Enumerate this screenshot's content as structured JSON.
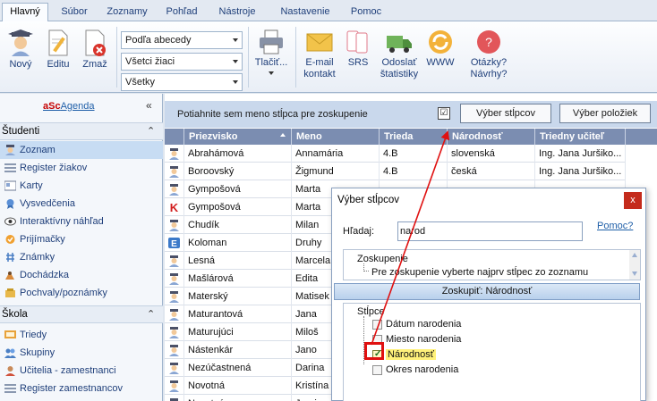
{
  "ribbon_tabs": [
    {
      "label": "Hlavný",
      "active": true
    },
    {
      "label": "Súbor",
      "active": false
    },
    {
      "label": "Zoznamy",
      "active": false
    },
    {
      "label": "Pohľad",
      "active": false
    },
    {
      "label": "Nástroje",
      "active": false
    },
    {
      "label": "Nastavenie",
      "active": false
    },
    {
      "label": "Pomoc",
      "active": false
    }
  ],
  "ribbon": {
    "new_label": "Nový",
    "edit_label": "Editu",
    "delete_label": "Zmaž",
    "sort_combo": "Podľa abecedy",
    "students_combo": "Všetci žiaci",
    "all_combo": "Všetky",
    "print_label": "Tlačiť...",
    "email_label_1": "E-mail",
    "email_label_2": "kontakt",
    "srs_label": "SRS",
    "stats_label_1": "Odoslať",
    "stats_label_2": "štatistiky",
    "www_label": "WWW",
    "questions_label_1": "Otázky?",
    "questions_label_2": "Návrhy?"
  },
  "sidebar": {
    "brand_prefix": "aSc",
    "brand_rest": "Agenda",
    "collapse": "«",
    "section_students": "Študenti",
    "section_school": "Škola",
    "chevron": "⌃",
    "student_items": [
      {
        "label": "Zoznam",
        "selected": true
      },
      {
        "label": "Register žiakov",
        "selected": false
      },
      {
        "label": "Karty",
        "selected": false
      },
      {
        "label": "Vysvedčenia",
        "selected": false
      },
      {
        "label": "Interaktívny náhľad",
        "selected": false
      },
      {
        "label": "Prijímačky",
        "selected": false
      },
      {
        "label": "Známky",
        "selected": false
      },
      {
        "label": "Dochádzka",
        "selected": false
      },
      {
        "label": "Pochvaly/poznámky",
        "selected": false
      }
    ],
    "school_items": [
      {
        "label": "Triedy"
      },
      {
        "label": "Skupiny"
      },
      {
        "label": "Učitelia - zamestnanci"
      },
      {
        "label": "Register zamestnancov"
      }
    ]
  },
  "grid": {
    "group_hint": "Potiahnite sem meno stĺpca pre zoskupenie",
    "group_checkbox": "☑",
    "column_chooser_button": "Výber stĺpcov",
    "item_chooser_button": "Výber položiek",
    "columns": [
      "Priezvisko",
      "Meno",
      "Trieda",
      "Národnosť",
      "Triedny učiteľ"
    ],
    "rows": [
      {
        "icon": "student",
        "surname": "Abrahámová",
        "name": "Annamária",
        "class": "4.B",
        "nationality": "slovenská",
        "teacher": "Ing. Jana Juršiko..."
      },
      {
        "icon": "student",
        "surname": "Boroovský",
        "name": "Žigmund",
        "class": "4.B",
        "nationality": "česká",
        "teacher": "Ing. Jana Juršiko..."
      },
      {
        "icon": "student",
        "surname": "Gympošová",
        "name": "Marta",
        "class": "",
        "nationality": "",
        "teacher": ""
      },
      {
        "icon": "k",
        "surname": "Gympošová",
        "name": "Marta",
        "class": "",
        "nationality": "",
        "teacher": ""
      },
      {
        "icon": "student",
        "surname": "Chudík",
        "name": "Milan",
        "class": "",
        "nationality": "",
        "teacher": ""
      },
      {
        "icon": "e",
        "surname": "Koloman",
        "name": "Druhy",
        "class": "",
        "nationality": "",
        "teacher": ""
      },
      {
        "icon": "student",
        "surname": "Lesná",
        "name": "Marcela",
        "class": "",
        "nationality": "",
        "teacher": ""
      },
      {
        "icon": "student",
        "surname": "Mašlárová",
        "name": "Edita",
        "class": "",
        "nationality": "",
        "teacher": ""
      },
      {
        "icon": "student",
        "surname": "Materský",
        "name": "Matisek",
        "class": "",
        "nationality": "",
        "teacher": ""
      },
      {
        "icon": "student",
        "surname": "Maturantová",
        "name": "Jana",
        "class": "",
        "nationality": "",
        "teacher": ""
      },
      {
        "icon": "student",
        "surname": "Maturujúci",
        "name": "Miloš",
        "class": "",
        "nationality": "",
        "teacher": ""
      },
      {
        "icon": "student",
        "surname": "Nástenkár",
        "name": "Jano",
        "class": "",
        "nationality": "",
        "teacher": ""
      },
      {
        "icon": "student",
        "surname": "Nezúčastnená",
        "name": "Darina",
        "class": "",
        "nationality": "",
        "teacher": ""
      },
      {
        "icon": "student",
        "surname": "Novotná",
        "name": "Kristína",
        "class": "",
        "nationality": "",
        "teacher": ""
      },
      {
        "icon": "student",
        "surname": "Novotný",
        "name": "Juraj",
        "class": "",
        "nationality": "",
        "teacher": ""
      }
    ]
  },
  "dialog": {
    "title": "Výber stĺpcov",
    "close": "x",
    "search_label": "Hľadaj:",
    "search_value": "narod",
    "help_link": "Pomoc?",
    "grouping_root": "Zoskupenie",
    "grouping_hint": "Pre zoskupenie vyberte najprv stĺpec zo zoznamu",
    "group_button": "Zoskupiť: Národnosť",
    "columns_root": "Stĺpce",
    "column_items": [
      {
        "label": "Dátum narodenia",
        "checked": false
      },
      {
        "label": "Miesto narodenia",
        "checked": false
      },
      {
        "label": "Národnosť",
        "checked": true
      },
      {
        "label": "Okres narodenia",
        "checked": false
      }
    ]
  },
  "colors": {
    "highlight_red": "#e01010",
    "selection_blue": "#c7dcf3",
    "header_blue": "#7b8db1"
  }
}
